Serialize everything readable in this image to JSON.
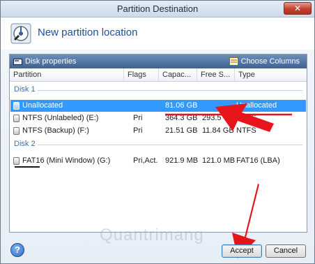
{
  "window": {
    "title": "Partition Destination",
    "close_glyph": "✕"
  },
  "header": {
    "title": "New partition location",
    "icon": "wizard-disk-icon"
  },
  "toolbar": {
    "disk_properties": "Disk properties",
    "choose_columns": "Choose Columns"
  },
  "columns": [
    "Partition",
    "Flags",
    "Capac...",
    "Free S...",
    "Type"
  ],
  "groups": [
    {
      "label": "Disk 1",
      "rows": [
        {
          "partition": "Unallocated",
          "flags": "",
          "capacity": "81.06 GB",
          "free": "",
          "type": "Unallocated",
          "selected": true
        },
        {
          "partition": "NTFS (Unlabeled) (E:)",
          "flags": "Pri",
          "capacity": "364.3 GB",
          "free": "293.5 GB",
          "type": "NTFS",
          "selected": false
        },
        {
          "partition": "NTFS (Backup) (F:)",
          "flags": "Pri",
          "capacity": "21.51 GB",
          "free": "11.84 GB",
          "type": "NTFS",
          "selected": false
        }
      ]
    },
    {
      "label": "Disk 2",
      "rows": [
        {
          "partition": "FAT16 (Mini Window) (G:)",
          "flags": "Pri,Act.",
          "capacity": "921.9 MB",
          "free": "121.0 MB",
          "type": "FAT16 (LBA)",
          "selected": false
        }
      ]
    }
  ],
  "footer": {
    "help_glyph": "?",
    "accept": "Accept",
    "cancel": "Cancel"
  },
  "watermark": "Quantrimang",
  "colors": {
    "selection": "#3399ff",
    "annotation": "#e8141c",
    "toolbar": "#4a6fa0"
  }
}
